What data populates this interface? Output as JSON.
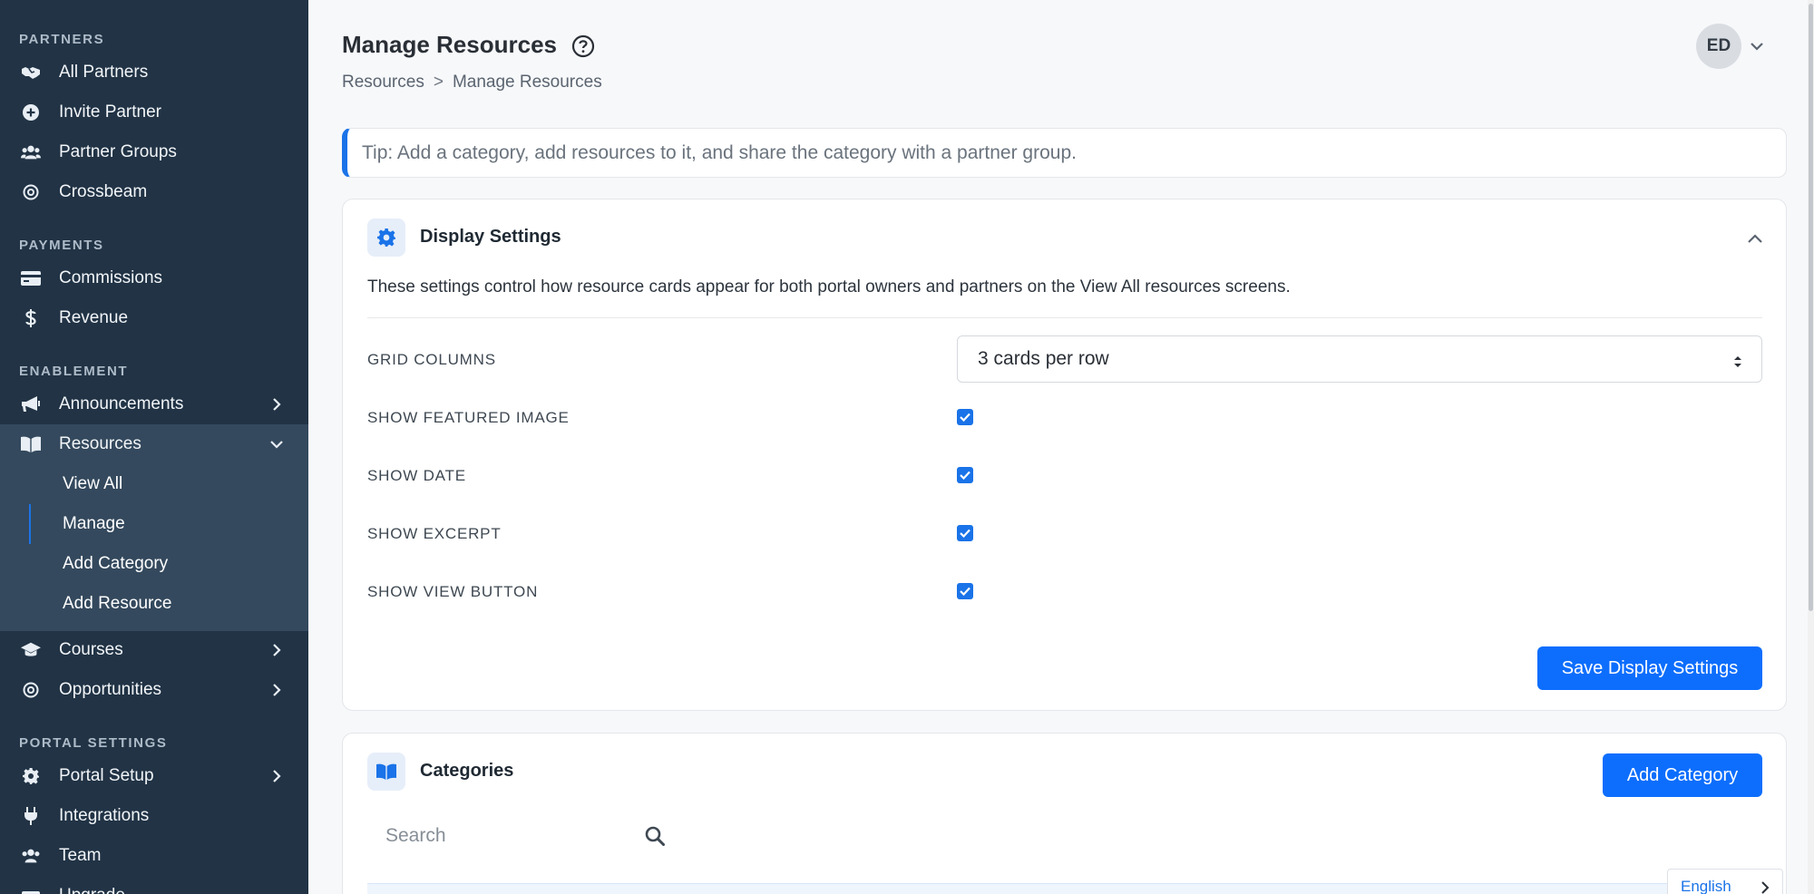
{
  "sidebar": {
    "sections": [
      {
        "label": "PARTNERS"
      },
      {
        "label": "PAYMENTS"
      },
      {
        "label": "ENABLEMENT"
      },
      {
        "label": "PORTAL SETTINGS"
      }
    ],
    "items": {
      "all_partners": "All Partners",
      "invite_partner": "Invite Partner",
      "partner_groups": "Partner Groups",
      "crossbeam": "Crossbeam",
      "commissions": "Commissions",
      "revenue": "Revenue",
      "announcements": "Announcements",
      "resources": "Resources",
      "courses": "Courses",
      "opportunities": "Opportunities",
      "portal_setup": "Portal Setup",
      "integrations": "Integrations",
      "team": "Team",
      "upgrade": "Upgrade"
    },
    "resources_sub": {
      "view_all": "View All",
      "manage": "Manage",
      "add_category": "Add Category",
      "add_resource": "Add Resource"
    }
  },
  "header": {
    "title": "Manage Resources",
    "breadcrumb": {
      "root": "Resources",
      "separator": ">",
      "current": "Manage Resources"
    },
    "avatar_initials": "ED"
  },
  "tip": "Tip: Add a category, add resources to it, and share the category with a partner group.",
  "display_settings": {
    "title": "Display Settings",
    "description": "These settings control how resource cards appear for both portal owners and partners on the View All resources screens.",
    "grid_columns_label": "GRID COLUMNS",
    "grid_columns_value": "3 cards per row",
    "show_featured_image_label": "SHOW FEATURED IMAGE",
    "show_date_label": "SHOW DATE",
    "show_excerpt_label": "SHOW EXCERPT",
    "show_view_button_label": "SHOW VIEW BUTTON",
    "save_button": "Save Display Settings"
  },
  "categories": {
    "title": "Categories",
    "add_button": "Add Category",
    "search_placeholder": "Search"
  },
  "language": "English",
  "colors": {
    "sidebar_bg": "#213345",
    "active_group_bg": "#34495d",
    "accent": "#0d6efd"
  }
}
